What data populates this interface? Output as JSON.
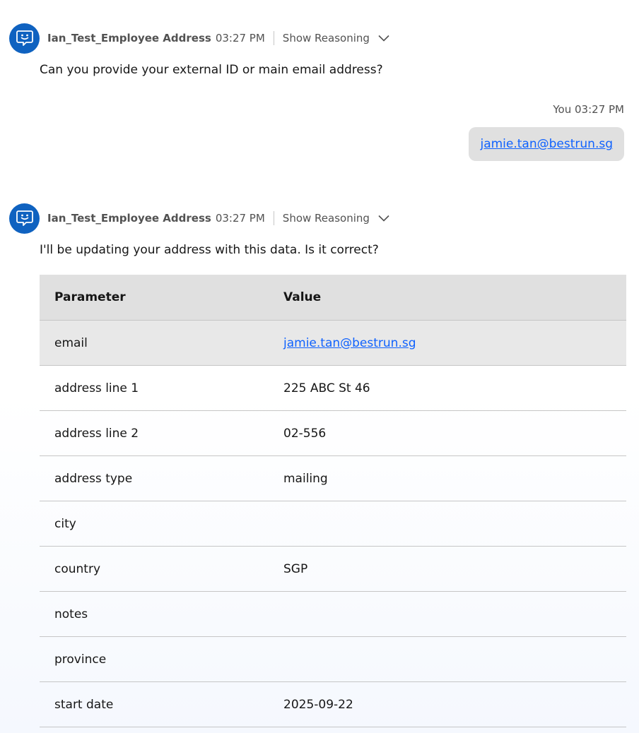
{
  "messages": [
    {
      "agent_name": "Ian_Test_Employee Address",
      "time": "03:27 PM",
      "show_reasoning_label": "Show Reasoning",
      "text": "Can you provide your external ID or main email address?"
    },
    {
      "agent_name": "Ian_Test_Employee Address",
      "time": "03:27 PM",
      "show_reasoning_label": "Show Reasoning",
      "text": "I'll be updating your address with this data. Is it correct?"
    }
  ],
  "user_message": {
    "meta": "You 03:27 PM",
    "text": "jamie.tan@bestrun.sg"
  },
  "table": {
    "headers": [
      "Parameter",
      "Value"
    ],
    "rows": [
      {
        "param": "email",
        "value": "jamie.tan@bestrun.sg"
      },
      {
        "param": "address line 1",
        "value": "225 ABC St 46"
      },
      {
        "param": "address line 2",
        "value": "02-556"
      },
      {
        "param": "address type",
        "value": "mailing"
      },
      {
        "param": "city",
        "value": ""
      },
      {
        "param": "country",
        "value": "SGP"
      },
      {
        "param": "notes",
        "value": ""
      },
      {
        "param": "province",
        "value": ""
      },
      {
        "param": "start date",
        "value": "2025-09-22"
      }
    ]
  },
  "colors": {
    "avatar": "#0f62c0",
    "link": "#0f62fe",
    "user_bubble": "#e0e0e0",
    "table_header": "#e0e0e0"
  },
  "icons": {
    "avatar": "chat-bot-icon",
    "expand": "chevron-down-icon"
  }
}
